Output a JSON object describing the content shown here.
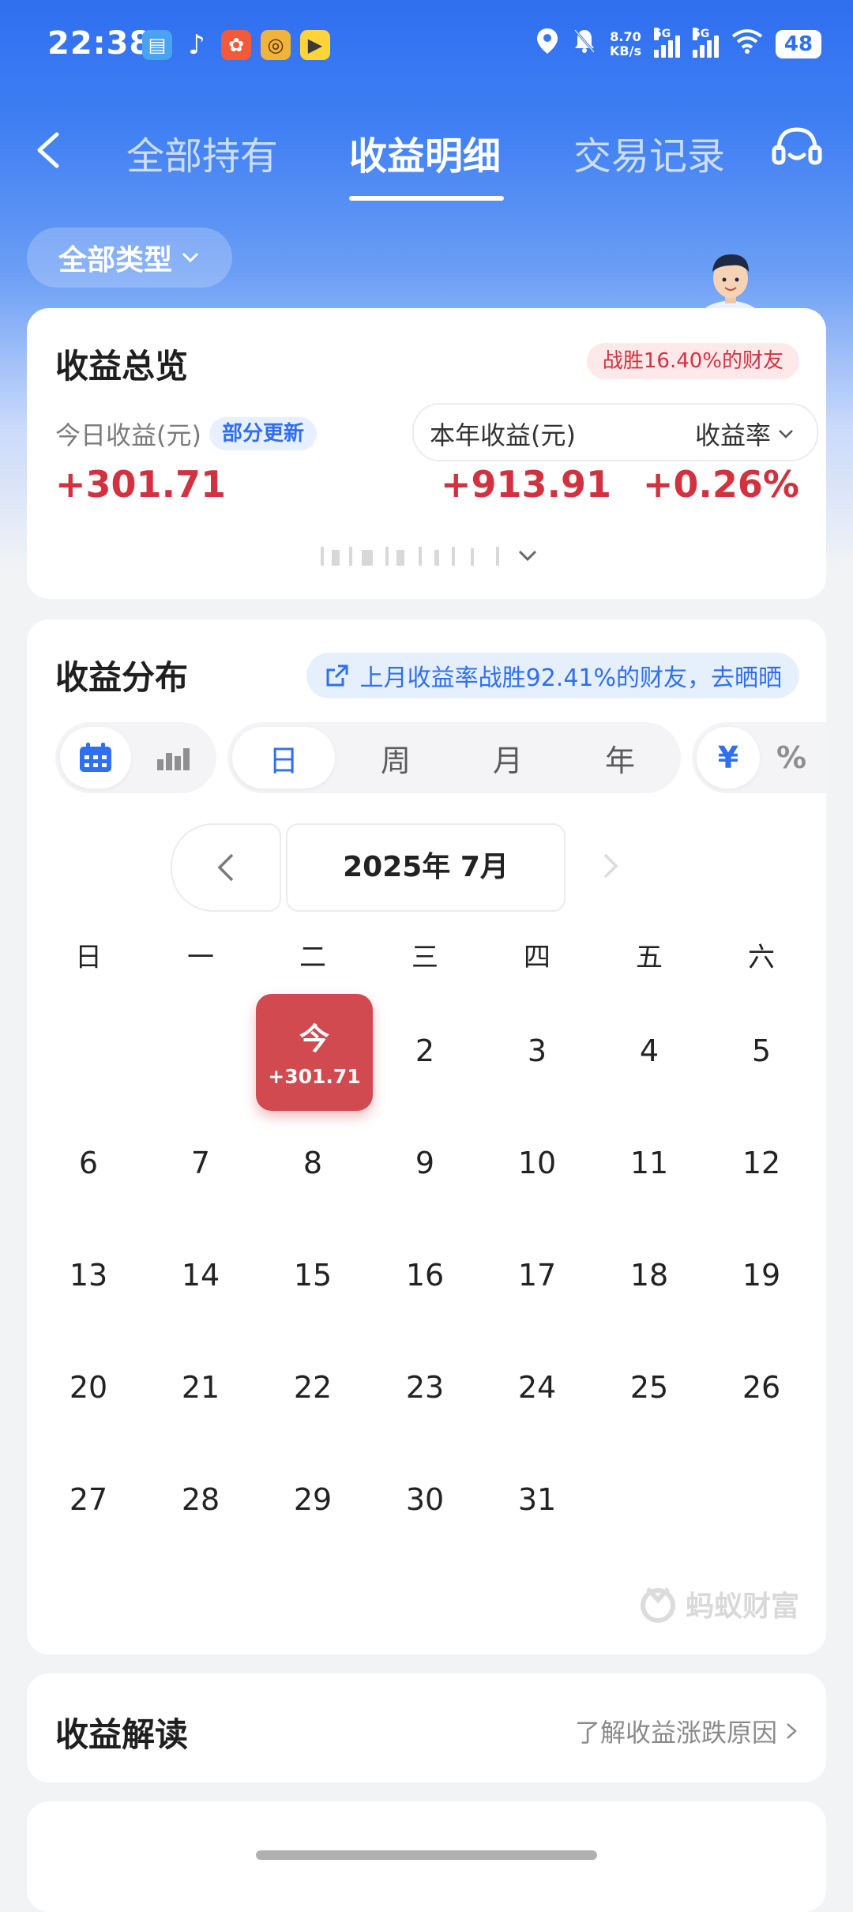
{
  "status_bar": {
    "time": "22:38",
    "network_speed_value": "8.70",
    "network_speed_unit": "KB/s",
    "signal1": "5G",
    "signal2": "5G",
    "battery": "48"
  },
  "nav": {
    "tabs": [
      "全部持有",
      "收益明细",
      "交易记录"
    ],
    "active_tab": "收益明细"
  },
  "filter": {
    "label": "全部类型"
  },
  "overview": {
    "title": "收益总览",
    "beat_badge": "战胜16.40%的财友",
    "today_label": "今日收益(元)",
    "partial_update": "部分更新",
    "today_value": "+301.71",
    "year_label": "本年收益(元)",
    "rate_label": "收益率",
    "year_value": "+913.91",
    "rate_value": "+0.26%"
  },
  "distribution": {
    "title": "收益分布",
    "share_text": "上月收益率战胜92.41%的财友，去晒晒",
    "periods": [
      "日",
      "周",
      "月",
      "年"
    ],
    "active_period": "日",
    "unit_yuan": "¥",
    "unit_pct": "%",
    "month": "2025年 7月",
    "weekdays": [
      "日",
      "一",
      "二",
      "三",
      "四",
      "五",
      "六"
    ],
    "today_label": "今",
    "today_value": "+301.71",
    "first_weekday": 2,
    "days_in_month": 31,
    "today_day": 1,
    "watermark": "蚂蚁财富"
  },
  "interpretation": {
    "title": "收益解读",
    "link": "了解收益涨跌原因"
  },
  "colors": {
    "brand_blue": "#2f6ff0",
    "gain_red": "#d2323f",
    "today_red": "#d04a4f"
  }
}
